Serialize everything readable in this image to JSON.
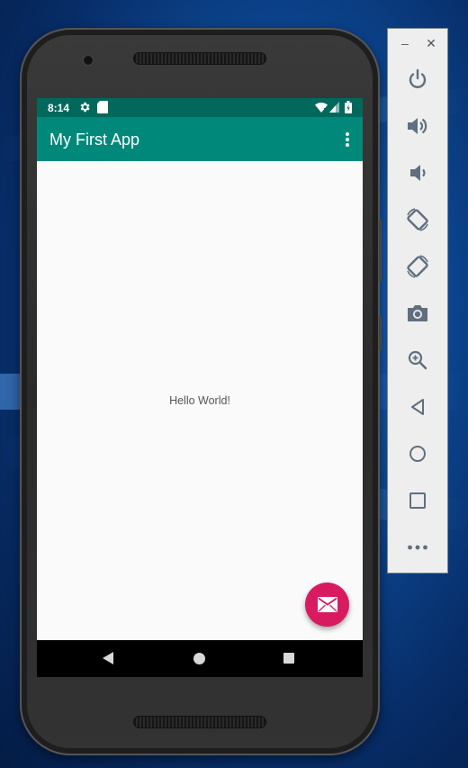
{
  "window": {
    "minimize_label": "–",
    "close_label": "✕"
  },
  "device": {
    "status_bar": {
      "time": "8:14",
      "icons": [
        "settings-icon",
        "sd-card-icon",
        "wifi-icon",
        "signal-icon",
        "battery-icon"
      ]
    },
    "app_bar": {
      "title": "My First App",
      "menu_icon": "overflow-menu-icon"
    },
    "content": {
      "text": "Hello World!"
    },
    "fab": {
      "icon": "email-icon",
      "color": "#d81b60"
    },
    "nav_bar": {
      "buttons": [
        "back-icon",
        "home-icon",
        "recents-icon"
      ]
    }
  },
  "emulator_toolbar": {
    "buttons": [
      {
        "icon": "power-icon"
      },
      {
        "icon": "volume-up-icon"
      },
      {
        "icon": "volume-down-icon"
      },
      {
        "icon": "rotate-left-icon"
      },
      {
        "icon": "rotate-right-icon"
      },
      {
        "icon": "camera-icon"
      },
      {
        "icon": "zoom-icon"
      },
      {
        "icon": "back-icon"
      },
      {
        "icon": "home-icon"
      },
      {
        "icon": "overview-icon"
      },
      {
        "icon": "more-icon"
      }
    ]
  },
  "colors": {
    "status_bar": "#00695c",
    "app_bar": "#00897b",
    "toolbar_icon": "#5f6f7f"
  }
}
